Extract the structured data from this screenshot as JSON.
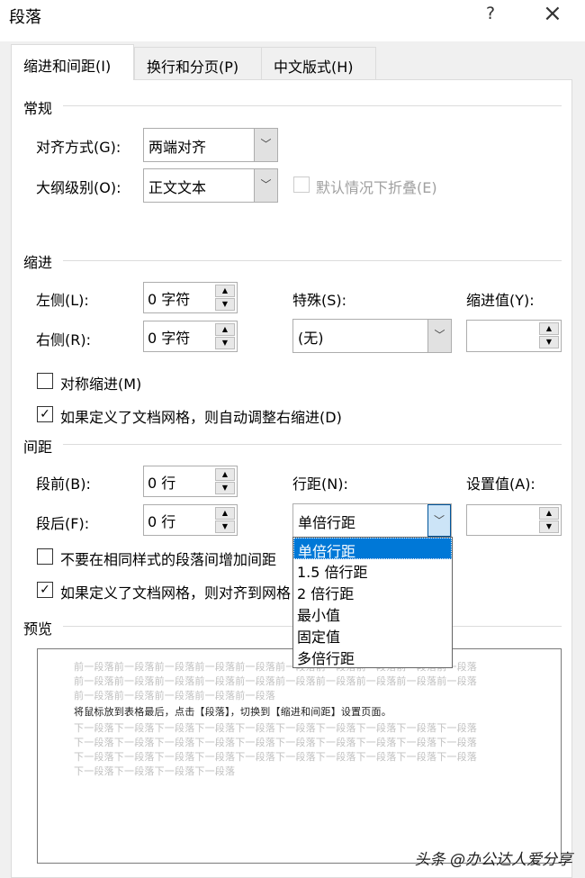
{
  "window": {
    "title": "段落",
    "help": "?",
    "close": "×"
  },
  "tabs": [
    "缩进和间距(I)",
    "换行和分页(P)",
    "中文版式(H)"
  ],
  "general": {
    "heading": "常规",
    "alignment_label": "对齐方式(G):",
    "alignment_value": "两端对齐",
    "outline_label": "大纲级别(O):",
    "outline_value": "正文文本",
    "collapse_label": "默认情况下折叠(E)"
  },
  "indent": {
    "heading": "缩进",
    "left_label": "左侧(L):",
    "left_value": "0 字符",
    "right_label": "右侧(R):",
    "right_value": "0 字符",
    "special_label": "特殊(S):",
    "special_value": "(无)",
    "by_label": "缩进值(Y):",
    "by_value": "",
    "mirror_label": "对称缩进(M)",
    "mirror_checked": false,
    "auto_label": "如果定义了文档网格，则自动调整右缩进(D)",
    "auto_checked": true
  },
  "spacing": {
    "heading": "间距",
    "before_label": "段前(B):",
    "before_value": "0 行",
    "after_label": "段后(F):",
    "after_value": "0 行",
    "line_label": "行距(N):",
    "line_value": "单倍行距",
    "at_label": "设置值(A):",
    "at_value": "",
    "no_space_label": "不要在相同样式的段落间增加间距",
    "no_space_checked": false,
    "snap_label": "如果定义了文档网格，则对齐到网格",
    "snap_checked": true
  },
  "line_spacing_options": [
    "单倍行距",
    "1.5 倍行距",
    "2 倍行距",
    "最小值",
    "固定值",
    "多倍行距"
  ],
  "preview": {
    "heading": "预览",
    "lines": [
      "前一段落前一段落前一段落前一段落前一段落前一段落前一段落前一段落前一段落前一段落",
      "前一段落前一段落前一段落前一段落前一段落前一段落前一段落前一段落前一段落前一段落",
      "前一段落前一段落前一段落前一段落前一段落",
      "将鼠标放到表格最后，点击【段落】，切换到【缩进和间距】设置页面。",
      "下一段落下一段落下一段落下一段落下一段落下一段落下一段落下一段落下一段落下一段落",
      "下一段落下一段落下一段落下一段落下一段落下一段落下一段落下一段落下一段落下一段落",
      "下一段落下一段落下一段落下一段落下一段落下一段落下一段落下一段落下一段落下一段落",
      "下一段落下一段落下一段落下一段落"
    ]
  },
  "watermark": "头条 @办公达人爱分享"
}
